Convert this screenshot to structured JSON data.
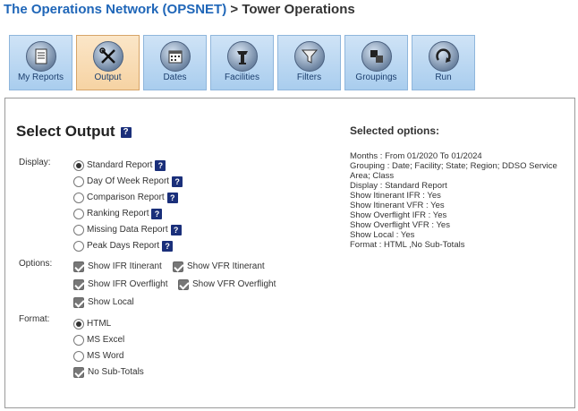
{
  "header": {
    "brand": "The Operations Network (OPSNET)",
    "separator": ">",
    "page": "Tower Operations"
  },
  "tabs": [
    {
      "label": "My Reports",
      "icon": "document-icon"
    },
    {
      "label": "Output",
      "icon": "tools-icon"
    },
    {
      "label": "Dates",
      "icon": "calendar-icon"
    },
    {
      "label": "Facilities",
      "icon": "tower-icon"
    },
    {
      "label": "Filters",
      "icon": "funnel-icon"
    },
    {
      "label": "Groupings",
      "icon": "groupings-icon"
    },
    {
      "label": "Run",
      "icon": "run-arrow-icon"
    }
  ],
  "active_tab": "Output",
  "main": {
    "title": "Select Output",
    "help_glyph": "?",
    "display_label": "Display:",
    "display_options": [
      {
        "label": "Standard Report",
        "selected": true
      },
      {
        "label": "Day Of Week Report",
        "selected": false
      },
      {
        "label": "Comparison Report",
        "selected": false
      },
      {
        "label": "Ranking Report",
        "selected": false
      },
      {
        "label": "Missing Data Report",
        "selected": false
      },
      {
        "label": "Peak Days Report",
        "selected": false
      }
    ],
    "options_label": "Options:",
    "options": [
      {
        "label": "Show IFR Itinerant",
        "checked": true
      },
      {
        "label": "Show VFR Itinerant",
        "checked": true
      },
      {
        "label": "Show IFR Overflight",
        "checked": true
      },
      {
        "label": "Show VFR Overflight",
        "checked": true
      },
      {
        "label": "Show Local",
        "checked": true
      }
    ],
    "format_label": "Format:",
    "format_options": [
      {
        "label": "HTML",
        "selected": true
      },
      {
        "label": "MS Excel",
        "selected": false
      },
      {
        "label": "MS Word",
        "selected": false
      }
    ],
    "subtotals": {
      "label": "No Sub-Totals",
      "checked": true
    }
  },
  "selected_options": {
    "title": "Selected options:",
    "lines": [
      "Months : From 01/2020 To 01/2024",
      "Grouping : Date; Facility; State; Region; DDSO Service Area; Class",
      "Display : Standard Report",
      "Show Itinerant IFR : Yes",
      "Show Itinerant VFR : Yes",
      "Show Overflight IFR : Yes",
      "Show Overflight VFR : Yes",
      "Show Local : Yes",
      "Format : HTML ,No Sub-Totals"
    ]
  },
  "colors": {
    "brand": "#1f66b8",
    "tab_bg": "#b7d6f2",
    "tab_active_bg": "#f8dcb4",
    "help_bg": "#1a2f7a"
  }
}
